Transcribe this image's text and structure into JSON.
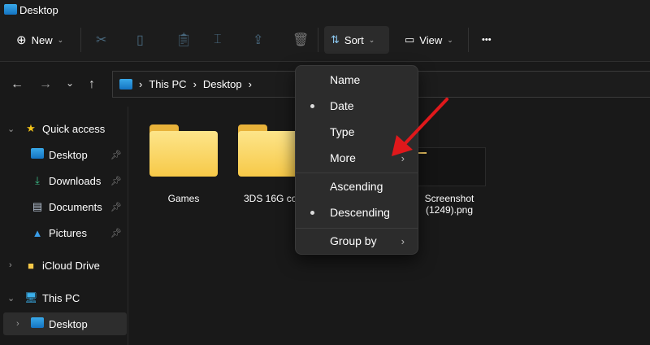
{
  "window": {
    "title": "Desktop"
  },
  "toolbar": {
    "new": "New",
    "sort": "Sort",
    "view": "View",
    "more": "•••",
    "icons": [
      "cut-icon",
      "copy-icon",
      "paste-icon",
      "rename-icon",
      "share-icon",
      "delete-icon"
    ]
  },
  "address": {
    "crumbs": [
      "This PC",
      "Desktop"
    ]
  },
  "sidebar": {
    "quick_access": "Quick access",
    "items": [
      "Desktop",
      "Downloads",
      "Documents",
      "Pictures"
    ],
    "icloud": "iCloud Drive",
    "this_pc": "This PC",
    "pc_desktop": "Desktop"
  },
  "files": [
    {
      "name": "Games"
    },
    {
      "name": "3DS 16G cop"
    },
    {
      "name": "Screenshot (1249).png"
    }
  ],
  "sort_menu": {
    "items": [
      "Name",
      "Date",
      "Type",
      "More"
    ],
    "order": [
      "Ascending",
      "Descending"
    ],
    "group_by": "Group by",
    "selected_sort": "Date",
    "selected_order": "Descending"
  },
  "colors": {
    "accent_arrow": "#e0181b",
    "folder": "#f7c948"
  }
}
